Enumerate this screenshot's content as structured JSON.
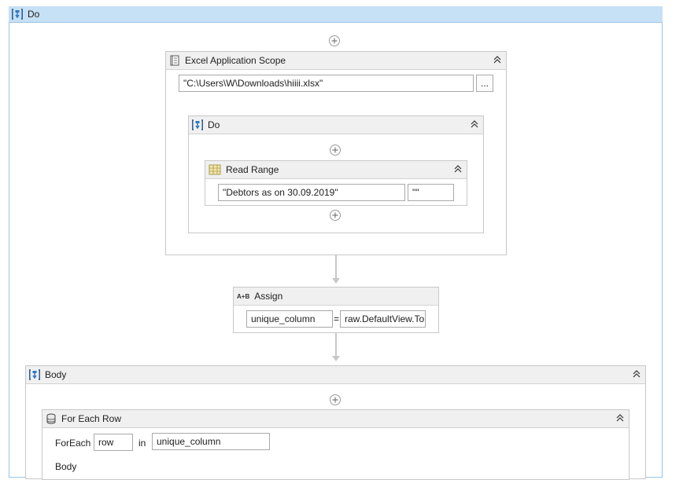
{
  "outer": {
    "title": "Do",
    "icon": "sequence-icon"
  },
  "excel_scope": {
    "title": "Excel Application Scope",
    "path_value": "\"C:\\Users\\W\\Downloads\\hiiii.xlsx\"",
    "browse_label": "..."
  },
  "inner_do": {
    "title": "Do"
  },
  "read_range": {
    "title": "Read Range",
    "sheet_value": "\"Debtors as on 30.09.2019\"",
    "range_value": "\"\""
  },
  "assign": {
    "title": "Assign",
    "icon_text": "A+B",
    "left_value": "unique_column",
    "equals": "=",
    "right_value": "raw.DefaultView.To"
  },
  "body": {
    "title": "Body"
  },
  "for_each_row": {
    "title": "For Each Row",
    "foreach_label": "ForEach",
    "item_value": "row",
    "in_label": "in",
    "collection_value": "unique_column",
    "body_label": "Body"
  }
}
